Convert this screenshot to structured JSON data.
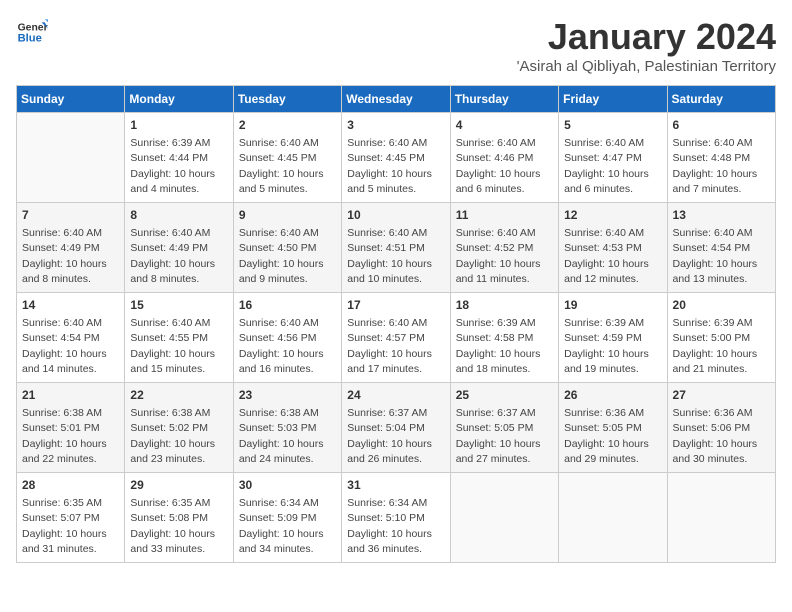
{
  "logo": {
    "line1": "General",
    "line2": "Blue"
  },
  "title": "January 2024",
  "location": "'Asirah al Qibliyah, Palestinian Territory",
  "headers": [
    "Sunday",
    "Monday",
    "Tuesday",
    "Wednesday",
    "Thursday",
    "Friday",
    "Saturday"
  ],
  "weeks": [
    [
      {
        "day": "",
        "info": ""
      },
      {
        "day": "1",
        "info": "Sunrise: 6:39 AM\nSunset: 4:44 PM\nDaylight: 10 hours\nand 4 minutes."
      },
      {
        "day": "2",
        "info": "Sunrise: 6:40 AM\nSunset: 4:45 PM\nDaylight: 10 hours\nand 5 minutes."
      },
      {
        "day": "3",
        "info": "Sunrise: 6:40 AM\nSunset: 4:45 PM\nDaylight: 10 hours\nand 5 minutes."
      },
      {
        "day": "4",
        "info": "Sunrise: 6:40 AM\nSunset: 4:46 PM\nDaylight: 10 hours\nand 6 minutes."
      },
      {
        "day": "5",
        "info": "Sunrise: 6:40 AM\nSunset: 4:47 PM\nDaylight: 10 hours\nand 6 minutes."
      },
      {
        "day": "6",
        "info": "Sunrise: 6:40 AM\nSunset: 4:48 PM\nDaylight: 10 hours\nand 7 minutes."
      }
    ],
    [
      {
        "day": "7",
        "info": "Sunrise: 6:40 AM\nSunset: 4:49 PM\nDaylight: 10 hours\nand 8 minutes."
      },
      {
        "day": "8",
        "info": "Sunrise: 6:40 AM\nSunset: 4:49 PM\nDaylight: 10 hours\nand 8 minutes."
      },
      {
        "day": "9",
        "info": "Sunrise: 6:40 AM\nSunset: 4:50 PM\nDaylight: 10 hours\nand 9 minutes."
      },
      {
        "day": "10",
        "info": "Sunrise: 6:40 AM\nSunset: 4:51 PM\nDaylight: 10 hours\nand 10 minutes."
      },
      {
        "day": "11",
        "info": "Sunrise: 6:40 AM\nSunset: 4:52 PM\nDaylight: 10 hours\nand 11 minutes."
      },
      {
        "day": "12",
        "info": "Sunrise: 6:40 AM\nSunset: 4:53 PM\nDaylight: 10 hours\nand 12 minutes."
      },
      {
        "day": "13",
        "info": "Sunrise: 6:40 AM\nSunset: 4:54 PM\nDaylight: 10 hours\nand 13 minutes."
      }
    ],
    [
      {
        "day": "14",
        "info": "Sunrise: 6:40 AM\nSunset: 4:54 PM\nDaylight: 10 hours\nand 14 minutes."
      },
      {
        "day": "15",
        "info": "Sunrise: 6:40 AM\nSunset: 4:55 PM\nDaylight: 10 hours\nand 15 minutes."
      },
      {
        "day": "16",
        "info": "Sunrise: 6:40 AM\nSunset: 4:56 PM\nDaylight: 10 hours\nand 16 minutes."
      },
      {
        "day": "17",
        "info": "Sunrise: 6:40 AM\nSunset: 4:57 PM\nDaylight: 10 hours\nand 17 minutes."
      },
      {
        "day": "18",
        "info": "Sunrise: 6:39 AM\nSunset: 4:58 PM\nDaylight: 10 hours\nand 18 minutes."
      },
      {
        "day": "19",
        "info": "Sunrise: 6:39 AM\nSunset: 4:59 PM\nDaylight: 10 hours\nand 19 minutes."
      },
      {
        "day": "20",
        "info": "Sunrise: 6:39 AM\nSunset: 5:00 PM\nDaylight: 10 hours\nand 21 minutes."
      }
    ],
    [
      {
        "day": "21",
        "info": "Sunrise: 6:38 AM\nSunset: 5:01 PM\nDaylight: 10 hours\nand 22 minutes."
      },
      {
        "day": "22",
        "info": "Sunrise: 6:38 AM\nSunset: 5:02 PM\nDaylight: 10 hours\nand 23 minutes."
      },
      {
        "day": "23",
        "info": "Sunrise: 6:38 AM\nSunset: 5:03 PM\nDaylight: 10 hours\nand 24 minutes."
      },
      {
        "day": "24",
        "info": "Sunrise: 6:37 AM\nSunset: 5:04 PM\nDaylight: 10 hours\nand 26 minutes."
      },
      {
        "day": "25",
        "info": "Sunrise: 6:37 AM\nSunset: 5:05 PM\nDaylight: 10 hours\nand 27 minutes."
      },
      {
        "day": "26",
        "info": "Sunrise: 6:36 AM\nSunset: 5:05 PM\nDaylight: 10 hours\nand 29 minutes."
      },
      {
        "day": "27",
        "info": "Sunrise: 6:36 AM\nSunset: 5:06 PM\nDaylight: 10 hours\nand 30 minutes."
      }
    ],
    [
      {
        "day": "28",
        "info": "Sunrise: 6:35 AM\nSunset: 5:07 PM\nDaylight: 10 hours\nand 31 minutes."
      },
      {
        "day": "29",
        "info": "Sunrise: 6:35 AM\nSunset: 5:08 PM\nDaylight: 10 hours\nand 33 minutes."
      },
      {
        "day": "30",
        "info": "Sunrise: 6:34 AM\nSunset: 5:09 PM\nDaylight: 10 hours\nand 34 minutes."
      },
      {
        "day": "31",
        "info": "Sunrise: 6:34 AM\nSunset: 5:10 PM\nDaylight: 10 hours\nand 36 minutes."
      },
      {
        "day": "",
        "info": ""
      },
      {
        "day": "",
        "info": ""
      },
      {
        "day": "",
        "info": ""
      }
    ]
  ]
}
